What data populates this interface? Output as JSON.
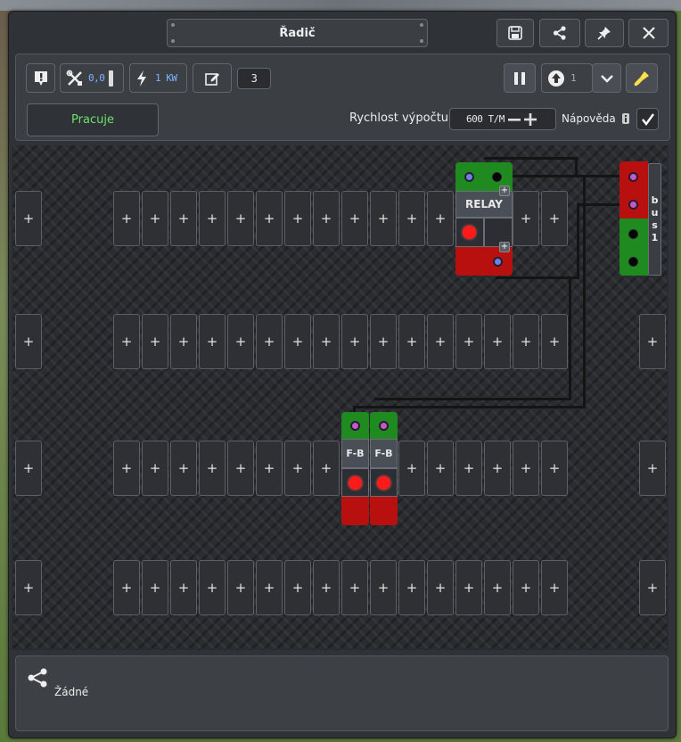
{
  "window": {
    "title": "Řadič"
  },
  "toolbar": {
    "tool_value": "0,0",
    "power_value": "1 KW",
    "edit_count": "3",
    "status_label": "Pracuje",
    "speed_label": "Rychlost výpočtu",
    "speed_value": "600 T/M",
    "help_label": "Nápověda",
    "help_checked": true,
    "step_value": "1"
  },
  "components": {
    "relay_label": "RELAY",
    "fb1_label": "F-B",
    "fb2_label": "F-B",
    "bus_label": "bus 1"
  },
  "footer": {
    "connection_label": "Žádné"
  },
  "colors": {
    "green": "#1f8a1f",
    "red": "#b80f0f",
    "status_text": "#6de06d",
    "accent_yellow": "#ffe04a"
  }
}
